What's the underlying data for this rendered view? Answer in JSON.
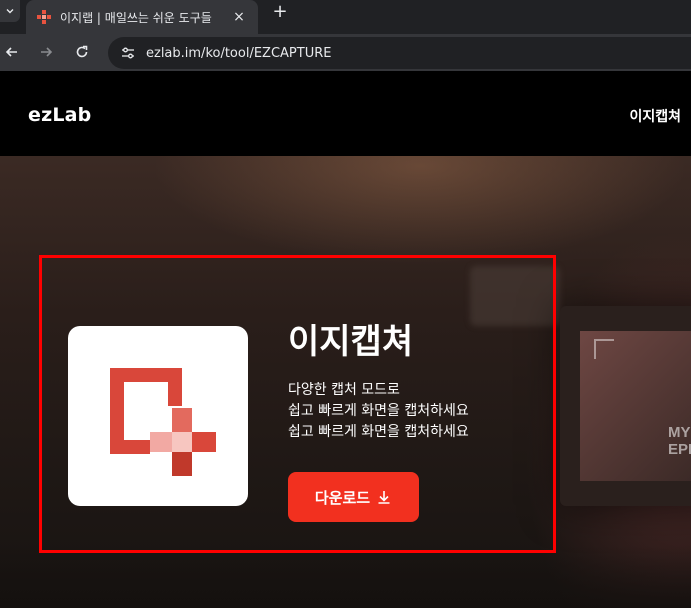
{
  "browser": {
    "tab_title": "이지랩 | 매일쓰는 쉬운 도구들",
    "tab_close": "×",
    "new_tab": "+",
    "url": "ezlab.im/ko/tool/EZCAPTURE"
  },
  "site": {
    "brand": "ezLab",
    "nav_link": "이지캡쳐"
  },
  "hero": {
    "title": "이지캡쳐",
    "desc_lines": [
      "다양한 캡처 모드로",
      "쉽고 빠르게 화면을 캡처하세요",
      "쉽고 빠르게 화면을 캡처하세요"
    ],
    "download_label": "다운로드",
    "background_text": [
      "MY",
      "EPIS"
    ]
  },
  "colors": {
    "accent": "#f2301f",
    "highlight_border": "#ff0000",
    "logo_red": "#d9473a",
    "logo_pink": "#f2a9a3"
  }
}
